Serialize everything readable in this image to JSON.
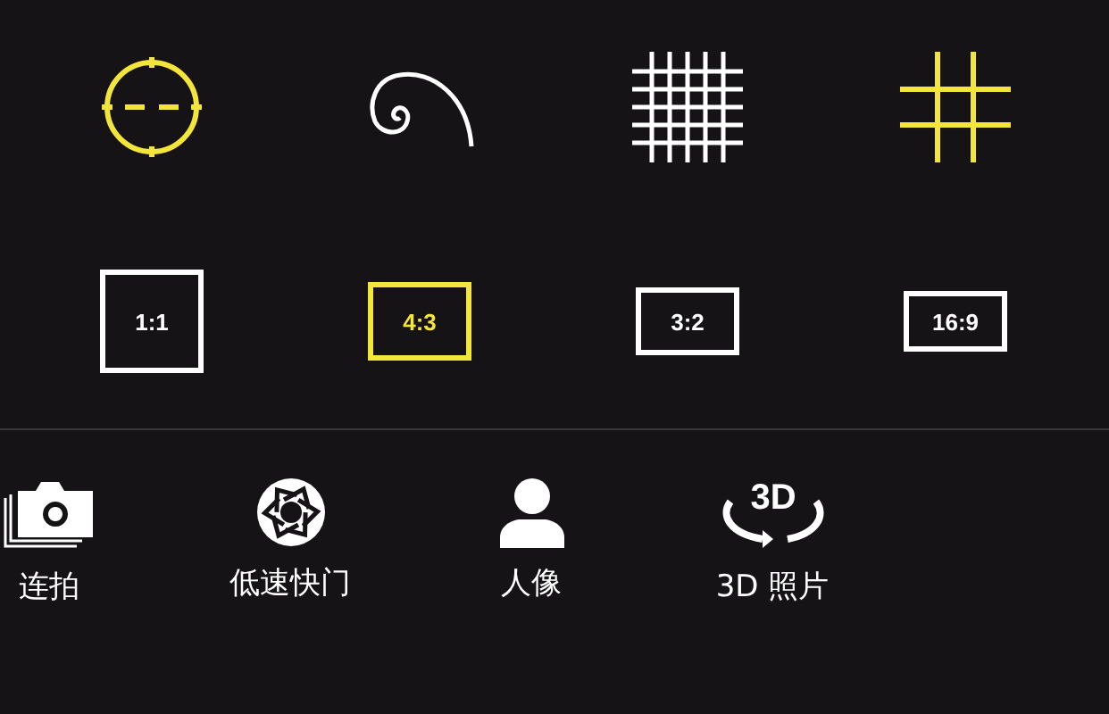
{
  "overlays": [
    {
      "kind": "level",
      "on": true
    },
    {
      "kind": "spiral",
      "on": false
    },
    {
      "kind": "grid",
      "on": false
    },
    {
      "kind": "thirds",
      "on": true
    }
  ],
  "ratios": [
    {
      "label": "1:1",
      "kind": "square",
      "selected": false
    },
    {
      "label": "4:3",
      "kind": "standard",
      "selected": true
    },
    {
      "label": "3:2",
      "kind": "classic",
      "selected": false
    },
    {
      "label": "16:9",
      "kind": "wide",
      "selected": false
    }
  ],
  "modes": [
    {
      "kind": "burst",
      "label": "连拍"
    },
    {
      "kind": "shutter",
      "label": "低速快门"
    },
    {
      "kind": "portrait",
      "label": "人像"
    },
    {
      "kind": "rotation",
      "label": "3D 照片",
      "icon_text": "3D"
    }
  ]
}
